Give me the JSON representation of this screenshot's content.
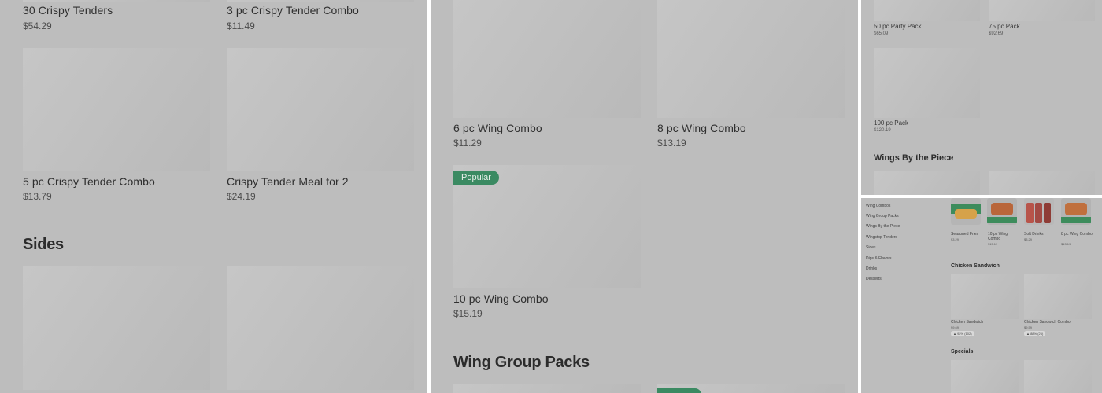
{
  "panel1": {
    "top_items": [
      {
        "name": "30 Crispy Tenders",
        "price": "$54.29"
      },
      {
        "name": "3 pc Crispy Tender Combo",
        "price": "$11.49"
      }
    ],
    "items": [
      {
        "name": "5 pc Crispy Tender Combo",
        "price": "$13.79"
      },
      {
        "name": "Crispy Tender Meal for 2",
        "price": "$24.19"
      }
    ],
    "section": "Sides"
  },
  "panel2": {
    "items": [
      {
        "name": "6 pc Wing Combo",
        "price": "$11.29"
      },
      {
        "name": "8 pc Wing Combo",
        "price": "$13.19"
      },
      {
        "name": "10 pc Wing Combo",
        "price": "$15.19",
        "badge": "Popular"
      }
    ],
    "section": "Wing Group Packs"
  },
  "panel3": {
    "items": [
      {
        "name": "50 pc Party Pack",
        "price": "$65.09"
      },
      {
        "name": "75 pc Pack",
        "price": "$92.69"
      },
      {
        "name": "100 pc Pack",
        "price": "$120.19"
      }
    ],
    "section": "Wings By the Piece"
  },
  "panel4": {
    "nav": [
      "Wing Combos",
      "Wing Group Packs",
      "Wings By the Piece",
      "Wingstop Tenders",
      "Sides",
      "Dips & Flavors",
      "Drinks",
      "Desserts"
    ],
    "featured": [
      {
        "name": "Seasoned Fries",
        "price": "$3.29"
      },
      {
        "name": "10 pc Wing Combo",
        "price": "$15.19"
      },
      {
        "name": "Soft Drinks",
        "price": "$3.29"
      },
      {
        "name": "8 pc Wing Combo",
        "price": "$13.19"
      }
    ],
    "section1": "Chicken Sandwich",
    "sandwiches": [
      {
        "name": "Chicken Sandwich",
        "price": "$9.69",
        "rating": "92% (102)"
      },
      {
        "name": "Chicken Sandwich Combo",
        "price": "$9.59",
        "rating": "88% (26)"
      }
    ],
    "section2": "Specials"
  },
  "colors": {
    "overlay": "#bdbdbd",
    "accent_green": "#3b8a62",
    "divider": "#ffffff"
  }
}
